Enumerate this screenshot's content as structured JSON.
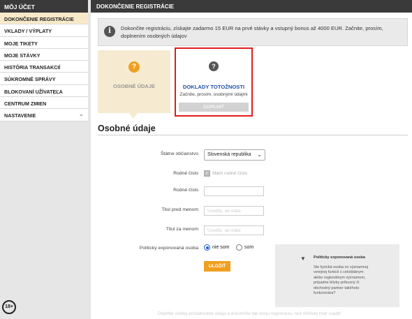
{
  "sidebar": {
    "title": "MÔJ ÚČET",
    "items": [
      {
        "label": "DOKONČENIE REGISTRÁCIE",
        "active": true
      },
      {
        "label": "VKLADY / VÝPLATY"
      },
      {
        "label": "MOJE TIKETY"
      },
      {
        "label": "MOJE STÁVKY"
      },
      {
        "label": "HISTÓRIA TRANSAKCIÍ"
      },
      {
        "label": "SÚKROMNÉ SPRÁVY"
      },
      {
        "label": "BLOKOVANÍ UŽÍVATEĽA"
      },
      {
        "label": "CENTRUM ZMIEN"
      },
      {
        "label": "NASTAVENIE",
        "has_chevron": true
      }
    ],
    "age_badge": "18+"
  },
  "header": {
    "title": "DOKONČENIE REGISTRÁCIE"
  },
  "notice": {
    "icon": "info-icon",
    "text": "Dokončite registráciu, získajte zadarmo 15 EUR na prvé stávky a vstupný bonus až 4000 EUR. Začnite, prosím, doplnením osobných údajov"
  },
  "steps": {
    "personal": {
      "icon": "question-icon",
      "label": "OSOBNÉ ÚDAJE",
      "color": "#f0a020"
    },
    "documents": {
      "icon": "question-icon",
      "title": "DOKLADY TOTOŽNOSTI",
      "subtitle": "Začnite, prosím, osobnými údajmi",
      "button": "DOPLNIŤ",
      "highlight_color": "#e21b1b"
    }
  },
  "form": {
    "section_title": "Osobné údaje",
    "citizenship_label": "Štátne občianstvo",
    "citizenship_value": "Slovenská republika",
    "birth_number_label": "Rodné číslo",
    "has_birth_number_label": "Mám rodné číslo",
    "has_birth_number_checked": true,
    "birth_number_label2": "Rodné číslo",
    "title_before_label": "Titul pred menom",
    "title_before_placeholder": "Uveďte, ak máte",
    "title_after_label": "Titul za menom",
    "title_after_placeholder": "Uveďte, ak máte",
    "pep_label": "Politicky exponovaná osoba",
    "pep_no": "nie som",
    "pep_yes": "som",
    "pep_selected": "nie som",
    "submit_label": "ULOŽIŤ"
  },
  "pep_info": {
    "icon": "pin-icon",
    "title": "Politicky exponovaná osoba",
    "description": "Ste fyzická osoba vo významnej verejnej funkcii s celoštátnym alebo regionálnym významom, prípadne blízky príbuzný či obchodný partner takéhoto funkcionára?"
  },
  "footer_note": "Doplňte všetky požadované údaje a dokončite tak svoju registráciu, než môžete hrať vsadiť",
  "colors": {
    "accent": "#f0a020",
    "link": "#1f4fa5",
    "dark_header": "#3a3a3a"
  }
}
